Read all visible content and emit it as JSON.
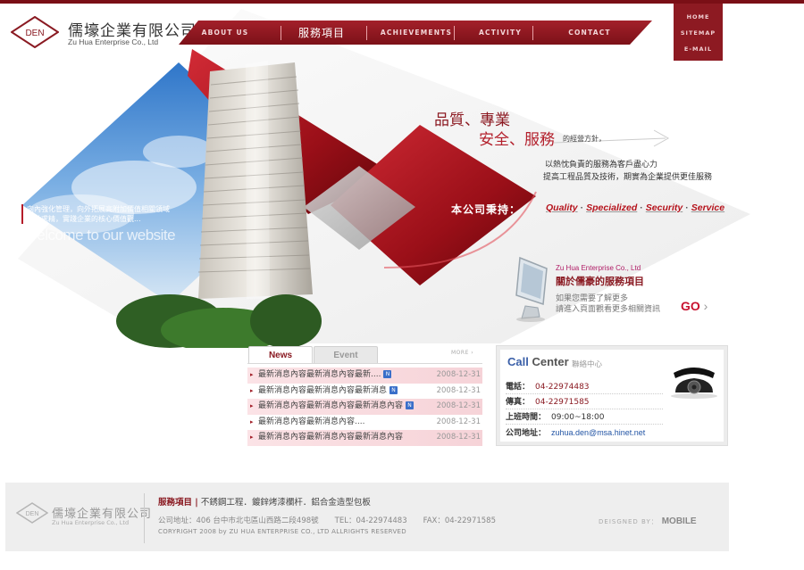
{
  "logo": {
    "badge": "DEN",
    "name_cn": "儒壕企業有限公司",
    "name_en": "Zu Hua Enterprise Co., Ltd"
  },
  "nav": {
    "items": [
      {
        "label": "ABOUT US"
      },
      {
        "label": "服務項目"
      },
      {
        "label": "ACHIEVEMENTS"
      },
      {
        "label": "ACTIVITY"
      },
      {
        "label": "CONTACT"
      }
    ]
  },
  "util": {
    "home": "HOME",
    "sitemap": "SITEMAP",
    "email": "E-MAIL"
  },
  "hero": {
    "small_slogan_1": "向內強化管理，向外拓展高附加價值相關領域",
    "small_slogan_2": "精益求精，實踐企業的核心價值觀...",
    "welcome": "Welcome to our website",
    "quality_1": "品質、專業",
    "quality_2": "安全、服務",
    "quality_tail": "的經營方針，",
    "line_1": "以熱忱負責的服務為客戶盡心力",
    "line_2": "提高工程品質及技術，期實為企業提供更佳服務",
    "bingchi": "本公司秉持：",
    "values": [
      "Quality",
      "Specialized",
      "Security",
      "Service"
    ]
  },
  "service": {
    "en": "Zu Hua Enterprise Co., Ltd",
    "title": "關於儒豪的服務項目",
    "line_1": "如果您需要了解更多",
    "line_2": "請進入頁面觀看更多相關資訊",
    "go": "GO"
  },
  "news": {
    "tab_news": "News",
    "tab_event": "Event",
    "more": "MORE",
    "items": [
      {
        "title": "最新消息內容最新消息內容最新....",
        "is_new": true,
        "date": "2008-12-31"
      },
      {
        "title": "最新消息內容最新消息內容最新消息",
        "is_new": true,
        "date": "2008-12-31"
      },
      {
        "title": "最新消息內容最新消息內容最新消息內容",
        "is_new": true,
        "date": "2008-12-31"
      },
      {
        "title": "最新消息內容最新消息內容....",
        "is_new": false,
        "date": "2008-12-31"
      },
      {
        "title": "最新消息內容最新消息內容最新消息內容",
        "is_new": false,
        "date": "2008-12-31"
      }
    ],
    "new_badge": "N"
  },
  "call": {
    "title_1": "Call",
    "title_2": "Center",
    "sub": "聯絡中心",
    "rows": [
      {
        "k": "電話：",
        "v": "04-22974483"
      },
      {
        "k": "傳真：",
        "v": "04-22971585"
      },
      {
        "k": "上班時間：",
        "v": "09:00~18:00"
      },
      {
        "k": "公司地址：",
        "v": "zuhua.den@msa.hinet.net"
      }
    ]
  },
  "footer": {
    "name_cn": "儒壕企業有限公司",
    "name_en": "Zu Hua Enterprise Co., Ltd",
    "svc_label": "服務項目 |",
    "svc_text": "不銹鋼工程．鍍鋅烤漆欄杆．鋁合金造型包板",
    "addr": "公司地址：406 台中市北屯區山西路二段498號",
    "tel": "TEL：04-22974483",
    "fax": "FAX：04-22971585",
    "copyright": "CORYRIGHT 2008 by ZU HUA ENTERPRISE CO., LTD ALLRIGHTS RESERVED",
    "designed_by": "DEISGNED BY：",
    "designer": "MOBILE"
  },
  "colors": {
    "brand": "#8d1a22",
    "accent": "#b5121b",
    "link": "#2355a5"
  }
}
